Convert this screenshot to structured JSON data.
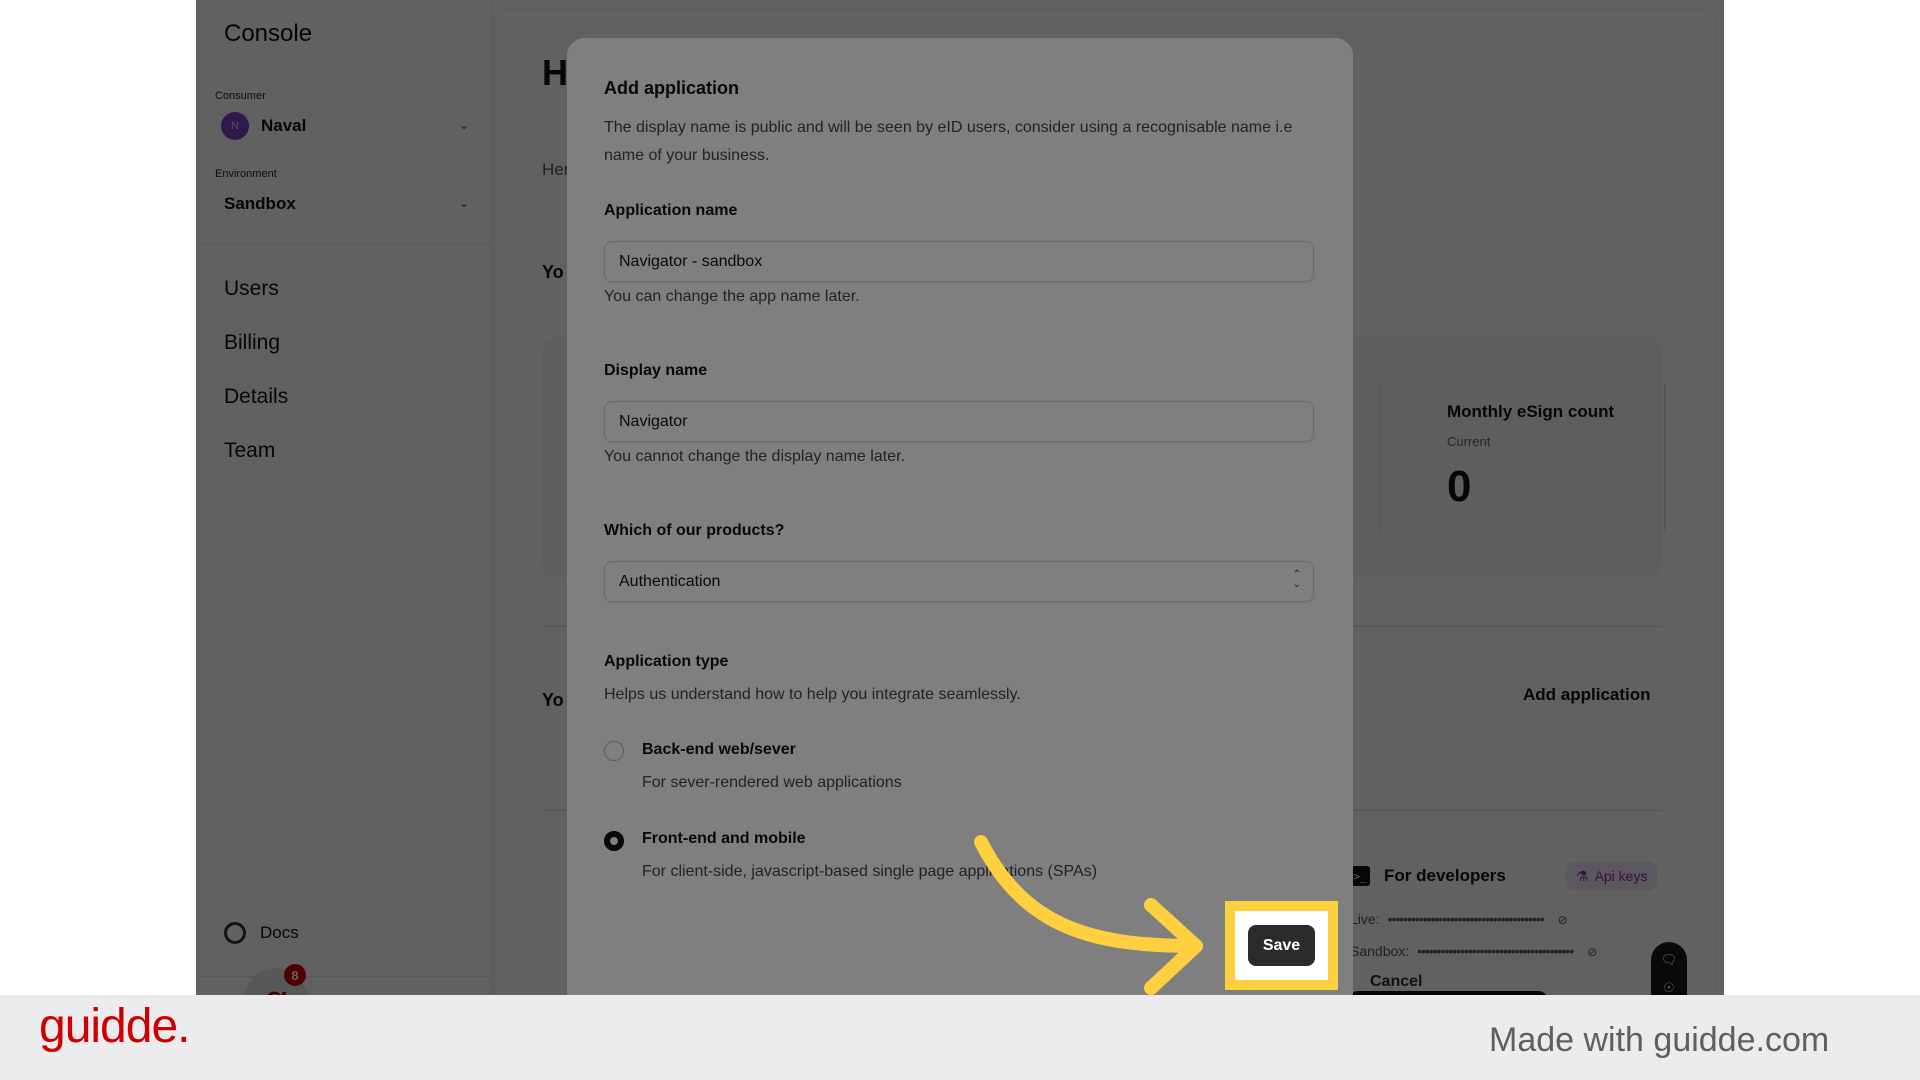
{
  "sidebar": {
    "title": "Console",
    "consumer_label": "Consumer",
    "consumer_initial": "N",
    "consumer_value": "Naval",
    "environment_label": "Environment",
    "environment_value": "Sandbox",
    "nav_items": [
      {
        "label": "Users"
      },
      {
        "label": "Billing"
      },
      {
        "label": "Details"
      },
      {
        "label": "Team"
      }
    ],
    "docs_label": "Docs",
    "helper_glyph": "α",
    "helper_badge_count": "8"
  },
  "page": {
    "title_partial": "H",
    "subtitle_partial": "Her",
    "section1_partial": "Yo",
    "section2_partial": "Yo",
    "stat": {
      "title": "Monthly eSign count",
      "subtitle": "Current",
      "value": "0"
    },
    "add_application_link": "Add application",
    "developers": {
      "title": "For developers",
      "term_glyph": ">_",
      "api_keys_label": "Api keys",
      "api_keys_icon": "flask-icon",
      "live_label": "Live:",
      "sandbox_label": "Sandbox:",
      "masked_key": "••••••••••••••••••••••••••••••••••••••••",
      "eye_icon": "eye-off-icon"
    }
  },
  "modal": {
    "title": "Add application",
    "description": "The display name is public and will be seen by eID users, consider using a recognisable name i.e name of your business.",
    "app_name": {
      "label": "Application name",
      "value": "Navigator - sandbox",
      "help": "You can change the app name later."
    },
    "display_name": {
      "label": "Display name",
      "value": "Navigator",
      "help": "You cannot change the display name later."
    },
    "product": {
      "label": "Which of our products?",
      "selected": "Authentication"
    },
    "app_type": {
      "label": "Application type",
      "help": "Helps us understand how to help you integrate seamlessly.",
      "options": [
        {
          "label": "Back-end web/sever",
          "help": "For sever-rendered web applications",
          "checked": false
        },
        {
          "label": "Front-end and mobile",
          "help": "For client-side, javascript-based single page applications (SPAs)",
          "checked": true
        }
      ]
    },
    "cancel_label": "Cancel",
    "save_label": "Save"
  },
  "annotation": {
    "highlight_color": "#fecf3f"
  },
  "footer": {
    "logo": "guidde.",
    "made_with": "Made with guidde.com",
    "brand_color": "#cc0000"
  }
}
